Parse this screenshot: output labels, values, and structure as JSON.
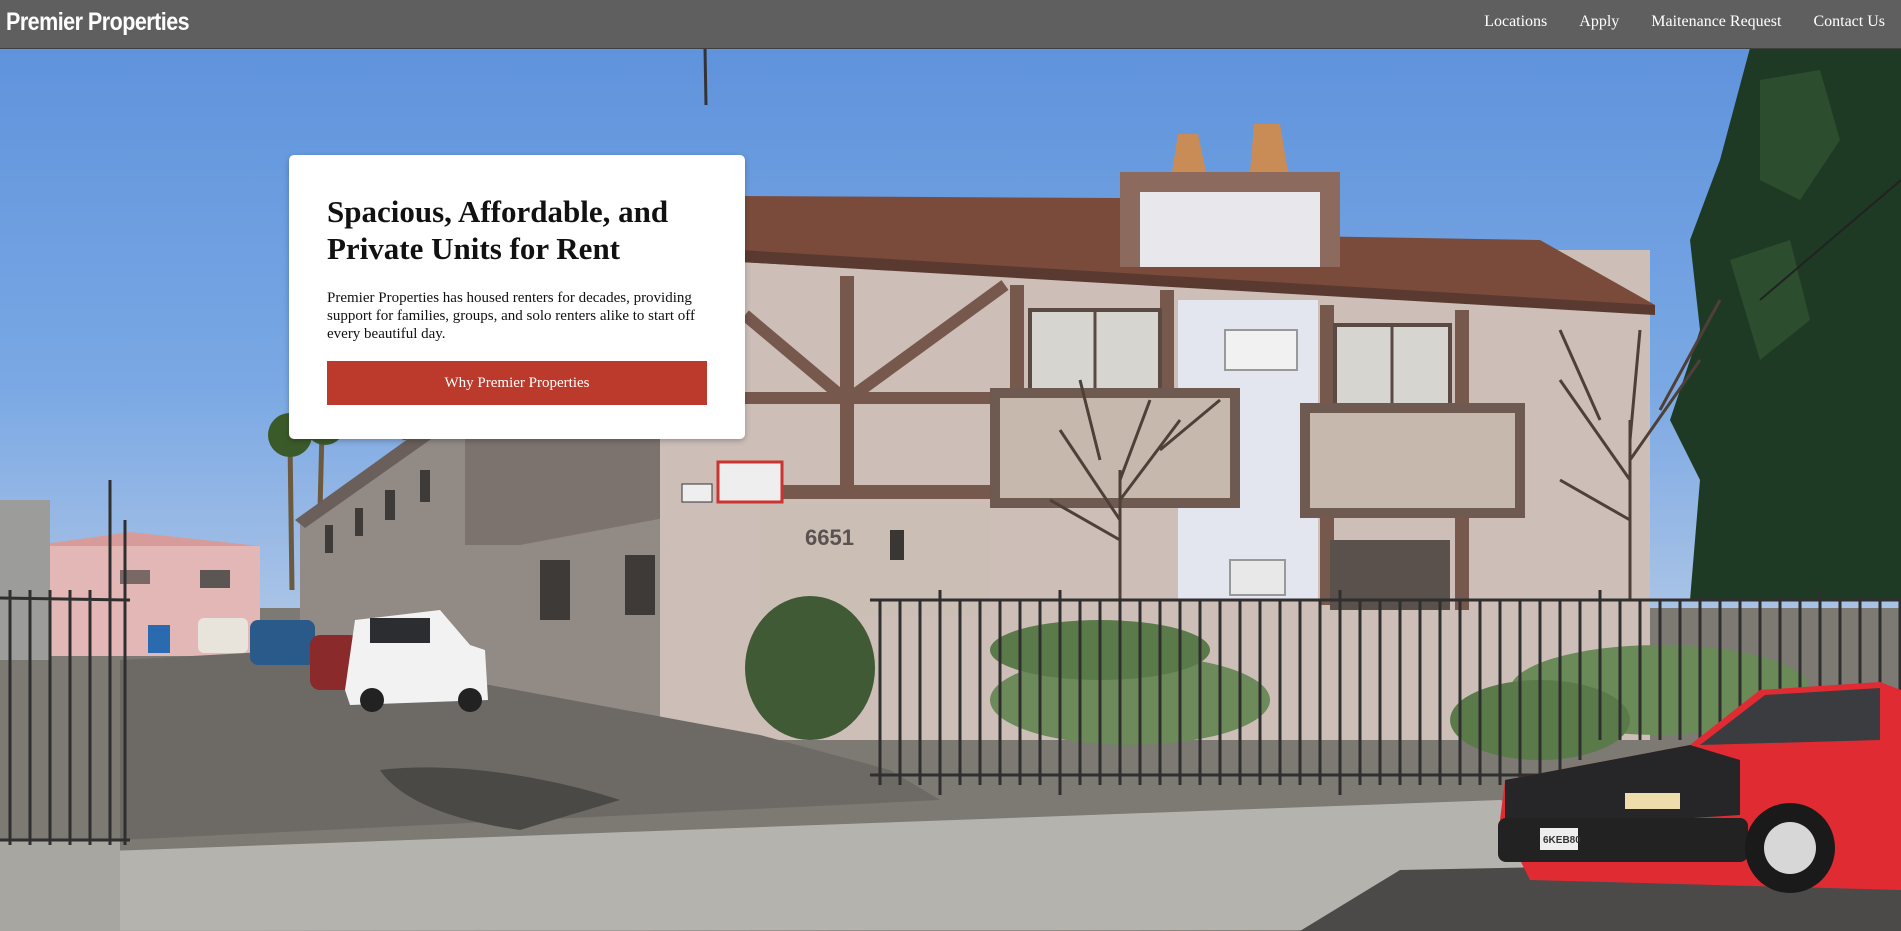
{
  "nav": {
    "brand": "Premier Properties",
    "links": [
      "Locations",
      "Apply",
      "Maitenance Request",
      "Contact Us"
    ]
  },
  "hero": {
    "image_alt": "Two-story apartment building with iron fence and parked cars",
    "building_number": "6651",
    "car_plate": "6KEB80"
  },
  "card": {
    "heading": "Spacious, Affordable, and Private Units for Rent",
    "body": "Premier Properties has housed renters for decades, providing support for families, groups, and solo renters alike to start off every beautiful day.",
    "button_label": "Why Premier Properties"
  },
  "colors": {
    "nav_bg": "#5f5f5f",
    "button_bg": "#bb3a2b",
    "sky": "#6e9ede"
  }
}
